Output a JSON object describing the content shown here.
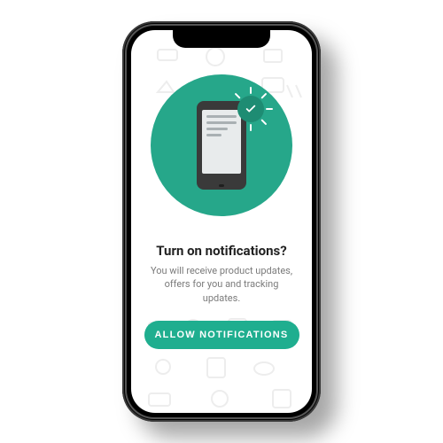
{
  "colors": {
    "accent": "#1fae8f",
    "hero_circle": "#26a78a",
    "check_badge": "#1e8c73"
  },
  "hero": {
    "illustration": "phone-with-check-icon"
  },
  "prompt": {
    "title": "Turn on notifications?",
    "body": "You will receive product updates, offers for you and tracking updates."
  },
  "buttons": {
    "allow_label": "ALLOW  NOTIFICATIONS"
  },
  "background_pattern_icons": [
    "car-icon",
    "soccer-ball-icon",
    "camera-icon",
    "gamepad-icon",
    "shoe-icon",
    "tshirt-icon",
    "watch-icon",
    "flipflops-icon",
    "football-icon",
    "bag-icon",
    "hat-icon",
    "tablet-icon"
  ]
}
